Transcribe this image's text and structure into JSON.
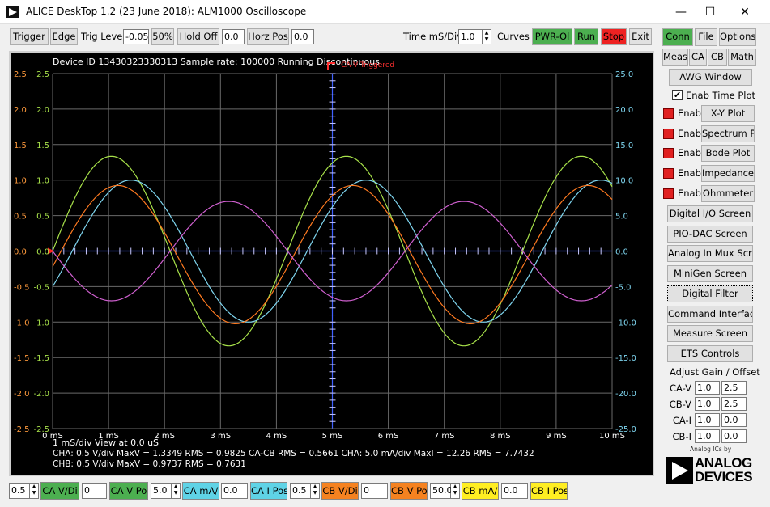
{
  "window": {
    "title": "ALICE DeskTop 1.2 (23 June 2018): ALM1000 Oscilloscope",
    "minimize": "—",
    "maximize": "☐",
    "close": "✕"
  },
  "toolbar": {
    "trigger": "Trigger",
    "edge": "Edge",
    "trig_level_label": "Trig Level",
    "trig_level_value": "-0.05",
    "fifty": "50%",
    "hold_off_label": "Hold Off",
    "hold_off_value": "0.0",
    "horz_pos_label": "Horz Pos",
    "horz_pos_value": "0.0",
    "time_div_label": "Time mS/Div",
    "time_div_value": "1.0",
    "curves": "Curves",
    "pwr": "PWR-Ol",
    "run": "Run",
    "stop": "Stop",
    "exit": "Exit"
  },
  "colors": {
    "pwr": "#4caf50",
    "run": "#4caf50",
    "stop": "#ee2222",
    "ca_v": "#4caf50",
    "ca_i": "#5fd3e6",
    "cb_v": "#f58220",
    "cb_i": "#ffee22",
    "trace_cav": "#a8e24a",
    "trace_cai": "#7fd6f0",
    "trace_cbv": "#ff7a20",
    "trace_cbi": "#d060d0",
    "axis": "#4060ff"
  },
  "scope": {
    "header": "Device ID 13430323330313 Sample rate: 100000 Running Discontinuous",
    "trigger_label": "CA-V Triggered",
    "left_ticks_outer": [
      "2.5",
      "2.0",
      "1.5",
      "1.0",
      "0.5",
      "0.0",
      "-0.5",
      "-1.0",
      "-1.5",
      "-2.0",
      "-2.5"
    ],
    "left_ticks_inner": [
      "2.5",
      "2.0",
      "1.5",
      "1.0",
      "0.5",
      "0.0",
      "-0.5",
      "-1.0",
      "-1.5",
      "-2.0",
      "-2.5"
    ],
    "right_ticks": [
      "25.0",
      "20.0",
      "15.0",
      "10.0",
      "5.0",
      "0.0",
      "-5.0",
      "-10.0",
      "-15.0",
      "-20.0",
      "-25.0"
    ],
    "x_ticks": [
      "0 mS",
      "1 mS",
      "2 mS",
      "3 mS",
      "4 mS",
      "5 mS",
      "6 mS",
      "7 mS",
      "8 mS",
      "9 mS",
      "10 mS"
    ],
    "line1": "1 mS/div  View at 0.0 uS",
    "line2": "CHA: 0.5 V/div MaxV = 1.3349 RMS = 0.9825 CA-CB RMS = 0.5661 CHA: 5.0 mA/div MaxI = 12.26 RMS = 7.7432",
    "line3": "CHB: 0.5 V/div MaxV = 0.9737 RMS = 0.7631"
  },
  "chart_data": {
    "type": "line",
    "xlabel": "",
    "ylabel": "",
    "x_range_ms": [
      0,
      10
    ],
    "ylim_volts": [
      -2.5,
      2.5
    ],
    "ylim_ma": [
      -25,
      25
    ],
    "grid": true,
    "series": [
      {
        "name": "CA-V",
        "amplitude": 1.3349,
        "period_ms": 4.2,
        "phase_deg": 0,
        "offset": 0
      },
      {
        "name": "CA-I",
        "amplitude": 1.0,
        "period_ms": 4.2,
        "phase_deg": -30,
        "offset": 0
      },
      {
        "name": "CB-V",
        "amplitude": 0.9737,
        "period_ms": 4.2,
        "phase_deg": -10,
        "offset": -0.05
      },
      {
        "name": "CB-I",
        "amplitude": 0.7,
        "period_ms": 4.2,
        "phase_deg": 180,
        "offset": 0
      }
    ]
  },
  "side": {
    "tab_conn": "Conn",
    "tab_file": "File",
    "tab_options": "Options",
    "tab_meas": "Meas",
    "tab_ca": "CA",
    "tab_cb": "CB",
    "tab_math": "Math",
    "awg": "AWG Window",
    "enab_time": "Enab Time Plot",
    "enab": "Enab",
    "xy": "X-Y Plot",
    "spectrum": "Spectrum Plot",
    "bode": "Bode Plot",
    "impedance": "Impedance",
    "ohmmeter": "Ohmmeter",
    "digital_io": "Digital I/O Screen",
    "pio_dac": "PIO-DAC Screen",
    "analog_mux": "Analog In Mux Screen",
    "minigen": "MiniGen Screen",
    "digital_filter": "Digital Filter",
    "command": "Command Interface",
    "measure": "Measure Screen",
    "ets": "ETS Controls",
    "adjust_title": "Adjust Gain / Offset",
    "adj_rows": [
      {
        "label": "CA-V",
        "gain": "1.0",
        "offset": "2.5"
      },
      {
        "label": "CB-V",
        "gain": "1.0",
        "offset": "2.5"
      },
      {
        "label": "CA-I",
        "gain": "1.0",
        "offset": "0.0"
      },
      {
        "label": "CB-I",
        "gain": "1.0",
        "offset": "0.0"
      }
    ],
    "logo_small": "Analog ICs by",
    "logo_line1": "ANALOG",
    "logo_line2": "DEVICES"
  },
  "bottom": {
    "ca_vdiv_val": "0.5",
    "ca_vdiv_label": "CA V/Di",
    "ca_vpos_val": "0",
    "ca_vpos_label": "CA V Po",
    "ca_ma_val": "5.0",
    "ca_ma_label": "CA mA/",
    "ca_ipos_val": "0.0",
    "ca_ipos_label": "CA I Pos",
    "cb_vdiv_val": "0.5",
    "cb_vdiv_label": "CB V/Di",
    "cb_vpos_val": "0",
    "cb_vpos_label": "CB V Po",
    "cb_ma_val": "50.0",
    "cb_ma_label": "CB mA/",
    "cb_ipos_val": "0.0",
    "cb_ipos_label": "CB I Pos"
  }
}
